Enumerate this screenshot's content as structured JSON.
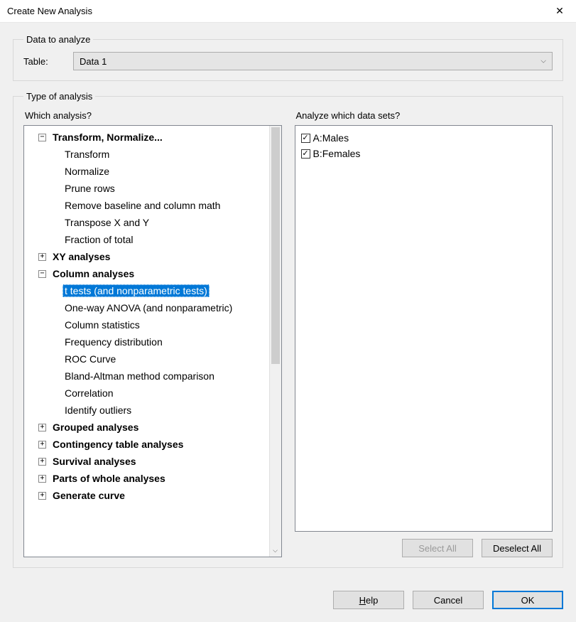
{
  "window": {
    "title": "Create New Analysis"
  },
  "dataToAnalyze": {
    "legend": "Data to analyze",
    "tableLabel": "Table:",
    "tableValue": "Data 1"
  },
  "typeOfAnalysis": {
    "legend": "Type of analysis",
    "whichAnalysisLabel": "Which analysis?",
    "analyzeDataSetsLabel": "Analyze which data sets?",
    "tree": {
      "transformGroup": "Transform, Normalize...",
      "transform": "Transform",
      "normalize": "Normalize",
      "pruneRows": "Prune rows",
      "removeBaseline": "Remove baseline and column math",
      "transpose": "Transpose X and Y",
      "fractionOfTotal": "Fraction of total",
      "xyAnalyses": "XY analyses",
      "columnAnalyses": "Column analyses",
      "tTests": "t tests (and nonparametric tests)",
      "oneWayAnova": "One-way ANOVA (and nonparametric)",
      "columnStatistics": "Column statistics",
      "frequencyDistribution": "Frequency distribution",
      "rocCurve": "ROC Curve",
      "blandAltman": "Bland-Altman method comparison",
      "correlation": "Correlation",
      "identifyOutliers": "Identify outliers",
      "groupedAnalyses": "Grouped analyses",
      "contingencyTable": "Contingency table analyses",
      "survivalAnalyses": "Survival analyses",
      "partsOfWhole": "Parts of whole analyses",
      "generateCurve": "Generate curve"
    },
    "datasets": {
      "a": "A:Males",
      "b": "B:Females"
    },
    "buttons": {
      "selectAll": "Select All",
      "deselectAll": "Deselect All"
    }
  },
  "bottom": {
    "helpPrefix": "H",
    "helpRest": "elp",
    "cancel": "Cancel",
    "ok": "OK"
  }
}
